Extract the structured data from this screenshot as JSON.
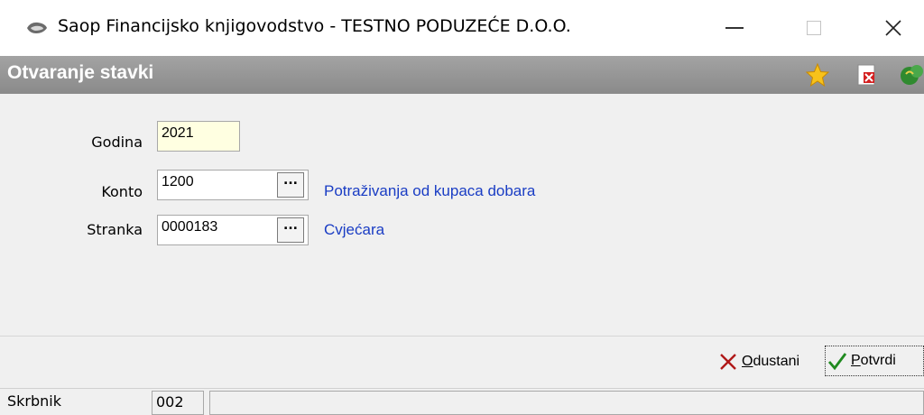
{
  "window": {
    "title": "Saop Financijsko knjigovodstvo - TESTNO PODUZEĆE D.O.O.",
    "controls": {
      "minimize": "—",
      "close": "✕"
    }
  },
  "header": {
    "title": "Otvaranje stavki",
    "icons": [
      "star-icon",
      "close-document-icon",
      "help-icon"
    ]
  },
  "form": {
    "godina": {
      "label": "Godina",
      "value": "2021"
    },
    "konto": {
      "label": "Konto",
      "value": "1200",
      "description": "Potraživanja od kupaca dobara",
      "browse": "..."
    },
    "stranka": {
      "label": "Stranka",
      "value": "0000183",
      "description": "Cvjećara",
      "browse": "..."
    }
  },
  "toolbar": {
    "cancel": {
      "mnemonic": "O",
      "rest": "dustani"
    },
    "confirm": {
      "mnemonic": "P",
      "rest": "otvrdi"
    }
  },
  "statusbar": {
    "label": "Skrbnik",
    "value": "002",
    "empty": ""
  },
  "colors": {
    "header_bg": "#8f8f8f",
    "panel_bg": "#f0f0f0",
    "link_blue": "#1a3dc4",
    "year_field_bg": "#ffffe1"
  }
}
